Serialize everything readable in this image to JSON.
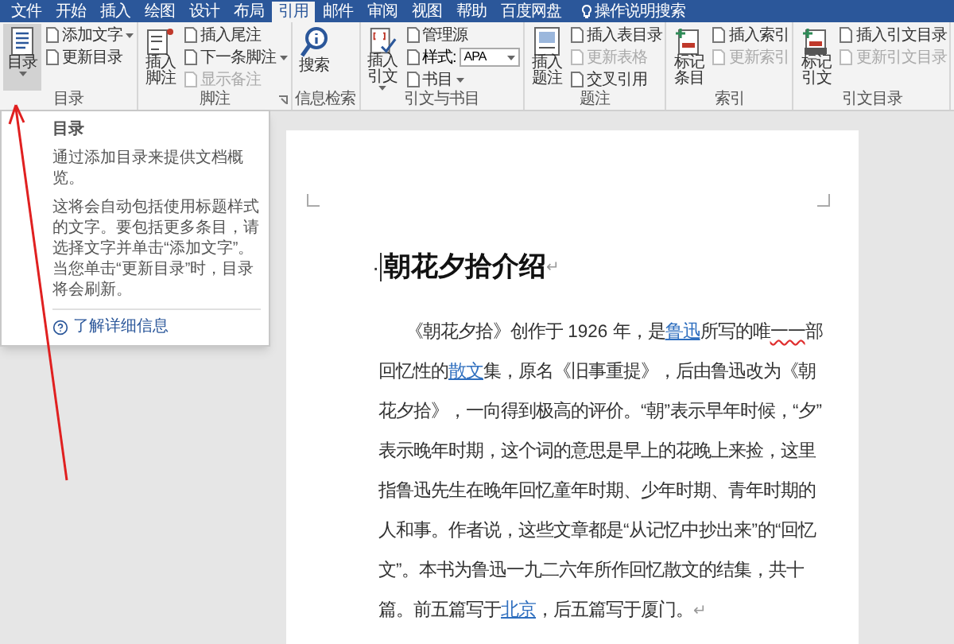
{
  "ribbon_tabs": [
    {
      "label": "文件",
      "selected": false
    },
    {
      "label": "开始",
      "selected": false
    },
    {
      "label": "插入",
      "selected": false
    },
    {
      "label": "绘图",
      "selected": false
    },
    {
      "label": "设计",
      "selected": false
    },
    {
      "label": "布局",
      "selected": false
    },
    {
      "label": "引用",
      "selected": true
    },
    {
      "label": "邮件",
      "selected": false
    },
    {
      "label": "审阅",
      "selected": false
    },
    {
      "label": "视图",
      "selected": false
    },
    {
      "label": "帮助",
      "selected": false
    },
    {
      "label": "百度网盘",
      "selected": false
    }
  ],
  "tell_me": "操作说明搜索",
  "groups": [
    {
      "label": "目录",
      "large": [
        {
          "label": "目录",
          "kind": "toc",
          "menu": true,
          "selected": true
        }
      ],
      "small": [
        {
          "kind": "button",
          "label": "添加文字",
          "menu": true,
          "disabled": false
        },
        {
          "kind": "button",
          "label": "更新目录",
          "menu": false,
          "disabled": false
        }
      ]
    },
    {
      "label": "脚注",
      "launcher": true,
      "large": [
        {
          "label": "插入脚注",
          "kind": "footnote",
          "menu": false,
          "selected": false
        }
      ],
      "small": [
        {
          "kind": "button",
          "label": "插入尾注",
          "menu": false,
          "disabled": false
        },
        {
          "kind": "button",
          "label": "下一条脚注",
          "menu": true,
          "disabled": false
        },
        {
          "kind": "button",
          "label": "显示备注",
          "menu": false,
          "disabled": true
        }
      ]
    },
    {
      "label": "信息检索",
      "large": [
        {
          "label": "搜索",
          "kind": "search",
          "menu": false,
          "selected": false
        }
      ]
    },
    {
      "label": "引文与书目",
      "large": [
        {
          "label": "插入引文",
          "kind": "citation",
          "menu": true,
          "selected": false
        }
      ],
      "small": [
        {
          "kind": "button",
          "label": "管理源",
          "menu": false,
          "disabled": false
        },
        {
          "kind": "dropdown",
          "label": "样式:",
          "value": "APA"
        },
        {
          "kind": "button",
          "label": "书目",
          "menu": true,
          "disabled": false
        }
      ]
    },
    {
      "label": "题注",
      "large": [
        {
          "label": "插入题注",
          "kind": "caption",
          "menu": false,
          "selected": false
        }
      ],
      "small": [
        {
          "kind": "button",
          "label": "插入表目录",
          "menu": false,
          "disabled": false
        },
        {
          "kind": "button",
          "label": "更新表格",
          "menu": false,
          "disabled": true
        },
        {
          "kind": "button",
          "label": "交叉引用",
          "menu": false,
          "disabled": false
        }
      ]
    },
    {
      "label": "索引",
      "large": [
        {
          "label": "标记条目",
          "kind": "mark-entry",
          "menu": false,
          "selected": false
        }
      ],
      "small": [
        {
          "kind": "button",
          "label": "插入索引",
          "menu": false,
          "disabled": false
        },
        {
          "kind": "button",
          "label": "更新索引",
          "menu": false,
          "disabled": true
        }
      ]
    },
    {
      "label": "引文目录",
      "large": [
        {
          "label": "标记引文",
          "kind": "mark-citation",
          "menu": false,
          "selected": false
        }
      ],
      "small": [
        {
          "kind": "button",
          "label": "插入引文目录",
          "menu": false,
          "disabled": false
        },
        {
          "kind": "button",
          "label": "更新引文目录",
          "menu": false,
          "disabled": true
        }
      ]
    }
  ],
  "tooltip": {
    "title": "目录",
    "paragraphs": [
      "通过添加目录来提供文档概览。",
      "这将会自动包括使用标题样式的文字。要包括更多条目，请选择文字并单击“添加文字”。当您单击“更新目录”时，目录将会刷新。"
    ],
    "link": "了解详细信息"
  },
  "document": {
    "heading_mark": "·",
    "heading": "朝花夕拾介绍",
    "heading_end": "↵",
    "paragraph_end": "↵",
    "lines": [
      [
        {
          "kind": "text",
          "text": "《朝花夕拾》创作于 1926 年，是"
        },
        {
          "kind": "link",
          "text": "鲁迅"
        },
        {
          "kind": "text",
          "text": "所写的唯"
        },
        {
          "kind": "misspelled",
          "text": "一一"
        },
        {
          "kind": "text",
          "text": "部"
        }
      ],
      [
        {
          "kind": "text",
          "text": "回忆性的"
        },
        {
          "kind": "link",
          "text": "散文"
        },
        {
          "kind": "text",
          "text": "集，原名《旧事重提》，后由鲁迅改为《朝"
        }
      ],
      [
        {
          "kind": "text",
          "text": "花夕拾》，一向得到极高的评价。“朝”表示早年时候，“夕”"
        }
      ],
      [
        {
          "kind": "text",
          "text": "表示晚年时期，这个词的意思是早上的花晚上来捡，这里"
        }
      ],
      [
        {
          "kind": "text",
          "text": "指鲁迅先生在晚年回忆童年时期、少年时期、青年时期的"
        }
      ],
      [
        {
          "kind": "text",
          "text": "人和事。作者说，这些文章都是“从记忆中抄出来”的“回忆"
        }
      ],
      [
        {
          "kind": "text",
          "text": "文”。本书为鲁迅一九二六年所作回忆散文的结集，共十"
        }
      ],
      [
        {
          "kind": "text",
          "text": "篇。前五篇写于"
        },
        {
          "kind": "link",
          "text": "北京"
        },
        {
          "kind": "text",
          "text": "，后五篇写于厦门。"
        }
      ]
    ]
  }
}
